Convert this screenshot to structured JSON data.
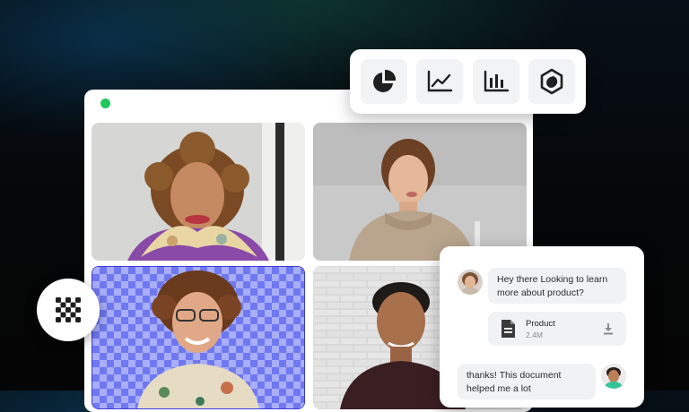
{
  "toolbar": {
    "tools": [
      {
        "icon": "pie-chart-icon"
      },
      {
        "icon": "line-chart-icon"
      },
      {
        "icon": "bar-chart-icon"
      },
      {
        "icon": "hexagon-shape-icon"
      }
    ]
  },
  "window": {
    "status_color": "#22c55e",
    "participants": [
      {
        "name": "participant-1"
      },
      {
        "name": "participant-2"
      },
      {
        "name": "participant-3",
        "background": "transparent-checkerboard"
      },
      {
        "name": "participant-4"
      }
    ]
  },
  "badge": {
    "icon": "mosaic-grid-icon"
  },
  "chat": {
    "message1": "Hey there Looking to learn more about product?",
    "file": {
      "name": "Product",
      "size": "2.4M"
    },
    "message2": "thanks!  This document helped me a lot"
  }
}
